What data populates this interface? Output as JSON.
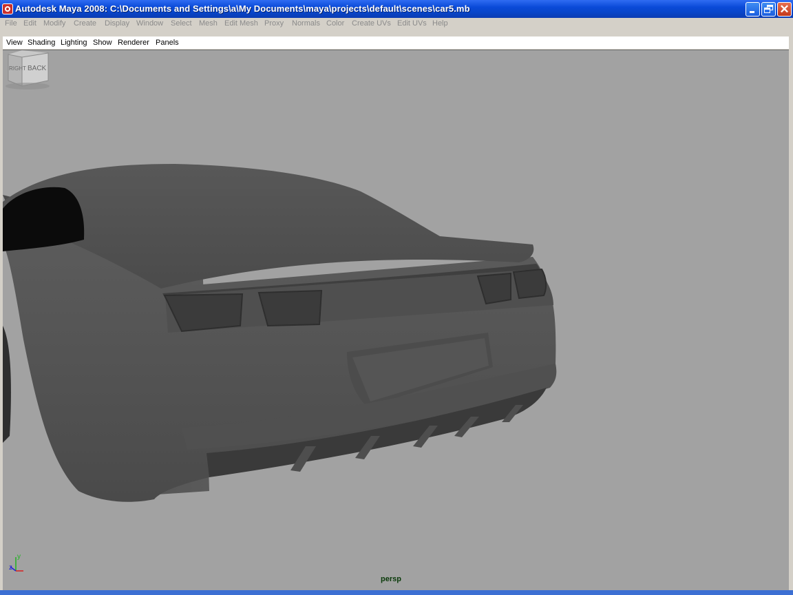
{
  "window": {
    "title": "Autodesk Maya 2008: C:\\Documents and Settings\\a\\My Documents\\maya\\projects\\default\\scenes\\car5.mb",
    "controls": {
      "minimize": "minimize",
      "restore": "restore",
      "close": "close"
    }
  },
  "menubar": [
    "File",
    "Edit",
    "Modify",
    "Create",
    "Display",
    "Window",
    "Select",
    "Mesh",
    "Edit Mesh",
    "Proxy",
    "Normals",
    "Color",
    "Create UVs",
    "Edit UVs",
    "Help"
  ],
  "panel_menu": [
    "View",
    "Shading",
    "Lighting",
    "Show",
    "Renderer",
    "Panels"
  ],
  "viewport": {
    "camera_name": "persp",
    "viewcube": {
      "left_face": "RIGHT",
      "right_face": "BACK"
    },
    "axis": {
      "y": "y",
      "z": "z"
    },
    "background_color": "#a2a2a2",
    "object": "car-rear-model"
  },
  "colors": {
    "titlebar": "#0a4ad8",
    "menu_text_disabled": "#8a8a8a"
  }
}
